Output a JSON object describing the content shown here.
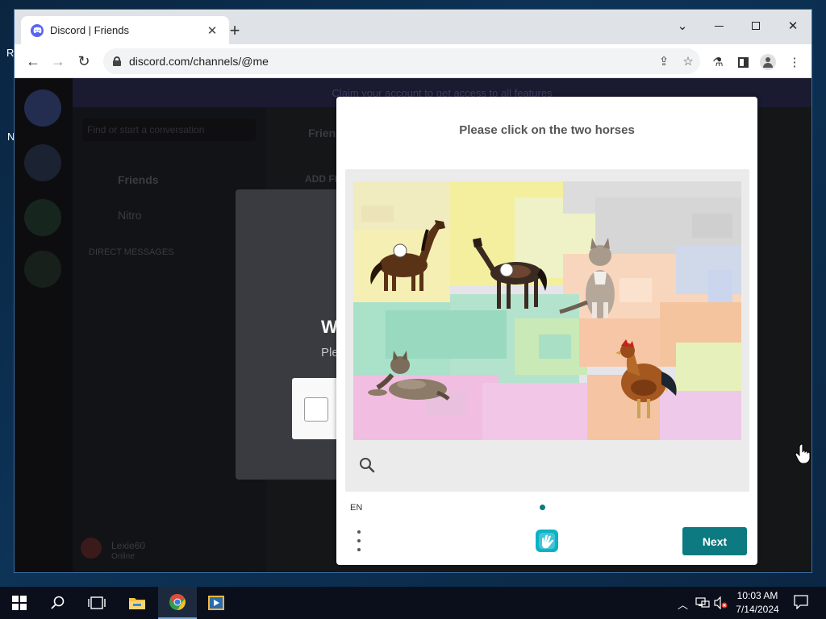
{
  "browser": {
    "tab_title": "Discord | Friends",
    "url": "discord.com/channels/@me",
    "controls": {
      "minimize": "minimize",
      "maximize": "maximize",
      "close": "close"
    }
  },
  "discord_bg": {
    "banner_text": "Claim your account to get access to all features",
    "search_placeholder": "Find or start a conversation",
    "friends_label": "Friends",
    "nitro_label": "Nitro",
    "dm_header": "DIRECT MESSAGES",
    "header_friends": "Friends",
    "add_friend": "ADD FRIEND",
    "dialog_title": "W",
    "dialog_text": "Ple",
    "user_name": "Lexie60",
    "user_status": "Online"
  },
  "captcha": {
    "prompt": "Please click on the two horses",
    "language": "EN",
    "next_label": "Next",
    "selections": [
      {
        "object": "horse"
      },
      {
        "object": "horse"
      }
    ],
    "image_objects": [
      "horse",
      "horse",
      "cat",
      "cat",
      "rooster"
    ]
  },
  "taskbar": {
    "time": "10:03 AM",
    "date": "7/14/2024",
    "apps": [
      "start",
      "search",
      "task-view",
      "file-explorer",
      "chrome",
      "media-player"
    ]
  },
  "colors": {
    "captcha_accent": "#0c7a80",
    "discord_blurple": "#5865f2",
    "page_dim": "#121214"
  }
}
